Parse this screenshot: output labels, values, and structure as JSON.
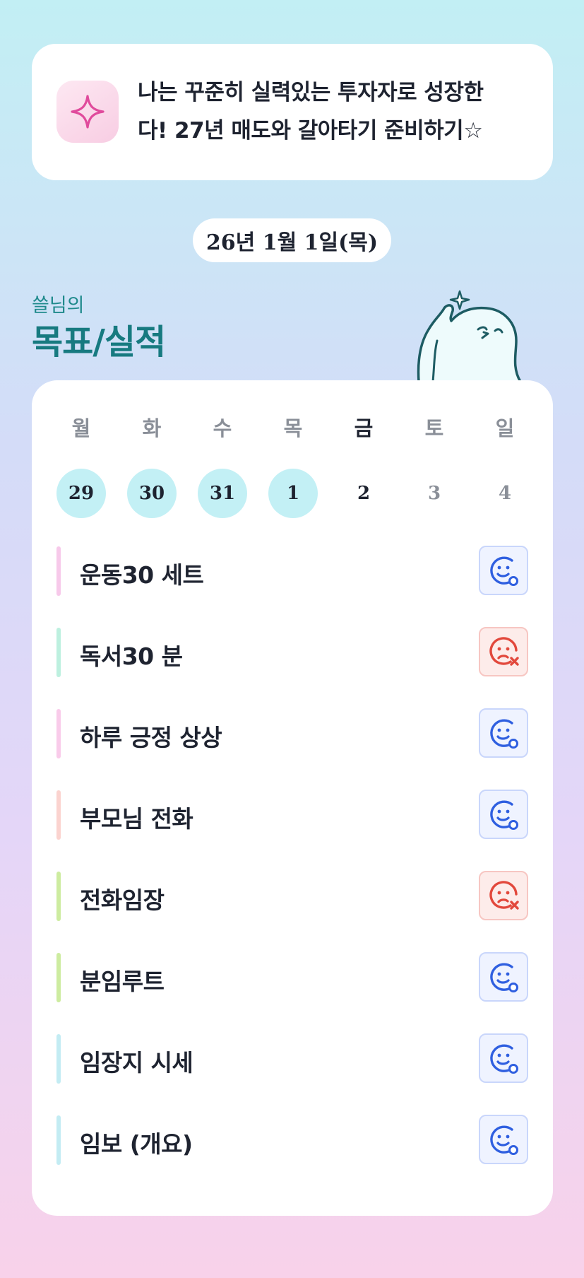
{
  "goal": {
    "line1": "나는 꾸준히 실력있는 투자자로 성장한",
    "line2": "다! 27년 매도와 갈아타기 준비하기☆",
    "icon": "sparkle-icon"
  },
  "date_label": "26년 1월 1일(목)",
  "section": {
    "subtitle": "쓸님의",
    "title": "목표/실적"
  },
  "week": {
    "days": [
      "월",
      "화",
      "수",
      "목",
      "금",
      "토",
      "일"
    ],
    "dates": [
      "29",
      "30",
      "31",
      "1",
      "2",
      "3",
      "4"
    ],
    "done_count": 4,
    "today_index": 4
  },
  "tasks": [
    {
      "label": "운동30 세트",
      "status": "happy",
      "bar_color": "#f7c9ea"
    },
    {
      "label": "독서30 분",
      "status": "sad",
      "bar_color": "#bdf0df"
    },
    {
      "label": "하루 긍정 상상",
      "status": "happy",
      "bar_color": "#f9cbea"
    },
    {
      "label": "부모님 전화",
      "status": "happy",
      "bar_color": "#fbd3cf"
    },
    {
      "label": "전화임장",
      "status": "sad",
      "bar_color": "#cdeca0"
    },
    {
      "label": "분임루트",
      "status": "happy",
      "bar_color": "#cdeca0"
    },
    {
      "label": "임장지 시세",
      "status": "happy",
      "bar_color": "#c3ecf3"
    },
    {
      "label": "임보 (개요)",
      "status": "happy",
      "bar_color": "#c3ecf3"
    }
  ],
  "colors": {
    "accent_teal": "#177a80",
    "done_circle": "#c3f0f5",
    "happy_icon": "#2f5fe0",
    "sad_icon": "#e2483c"
  }
}
